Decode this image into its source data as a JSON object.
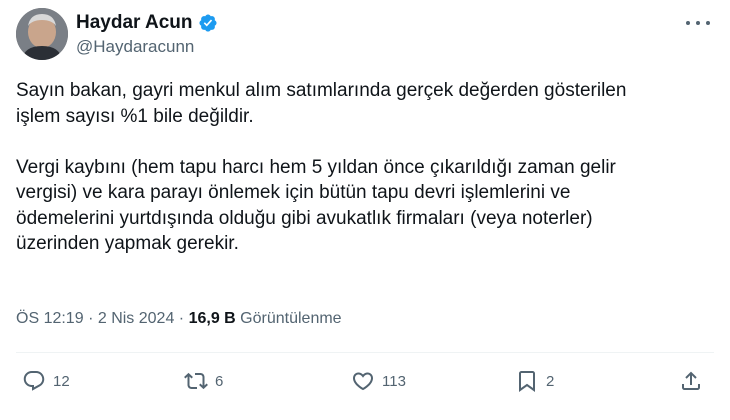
{
  "author": {
    "display_name": "Haydar Acun",
    "handle": "@Haydaracunn",
    "verified_color": "#1d9bf0"
  },
  "icons": {
    "verified": "verified-badge-icon",
    "more": "more-icon",
    "reply": "reply-icon",
    "retweet": "retweet-icon",
    "like": "heart-icon",
    "bookmark": "bookmark-icon",
    "share": "share-icon"
  },
  "tweet": {
    "paragraphs": [
      "Sayın bakan, gayri menkul alım satımlarında gerçek değerden gösterilen\nişlem sayısı %1 bile değildir.",
      "Vergi kaybını (hem tapu harcı hem 5 yıldan önce çıkarıldığı zaman gelir\nvergisi) ve kara parayı önlemek için bütün tapu devri işlemlerini ve\nödemelerini yurtdışında olduğu gibi avukatlık firmaları (veya noterler)\nüzerinden yapmak gerekir."
    ],
    "time": "ÖS 12:19",
    "separator": "·",
    "date": "2 Nis 2024",
    "views_count": "16,9 B",
    "views_label": "Görüntülenme"
  },
  "actions": {
    "replies": "12",
    "retweets": "6",
    "likes": "113",
    "bookmarks": "2"
  },
  "colors": {
    "text": "#0f1419",
    "secondary": "#536471",
    "divider": "#eff3f4"
  }
}
